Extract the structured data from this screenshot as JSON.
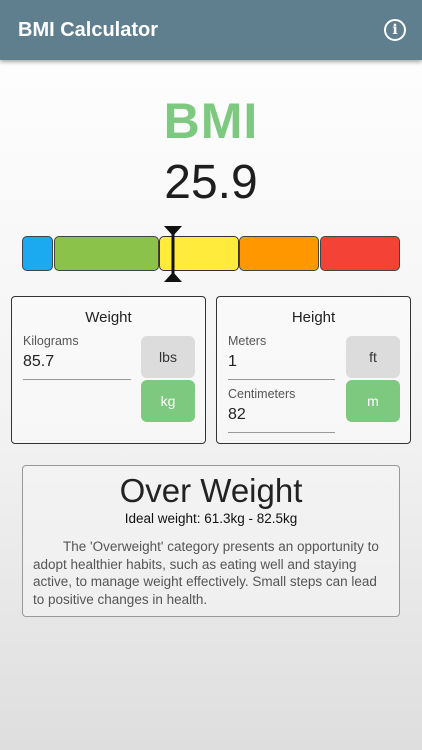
{
  "app": {
    "title": "BMI Calculator",
    "info_icon": "info-circle-icon"
  },
  "bmi": {
    "label": "BMI",
    "value": "25.9",
    "label_color": "#7dc97f"
  },
  "scale": {
    "segments": [
      {
        "name": "underweight",
        "color": "#1ba9f0"
      },
      {
        "name": "normal",
        "color": "#8bc34a"
      },
      {
        "name": "overweight",
        "color": "#ffeb3b"
      },
      {
        "name": "obese",
        "color": "#ff9800"
      },
      {
        "name": "extremely-obese",
        "color": "#f44336"
      }
    ],
    "active_segment": "overweight"
  },
  "weight": {
    "title": "Weight",
    "field_label": "Kilograms",
    "value": "85.7",
    "units": {
      "lbs": "lbs",
      "kg": "kg"
    },
    "selected_unit": "kg"
  },
  "height": {
    "title": "Height",
    "meters_label": "Meters",
    "meters_value": "1",
    "cm_label": "Centimeters",
    "cm_value": "82",
    "units": {
      "ft": "ft",
      "m": "m"
    },
    "selected_unit": "m"
  },
  "result": {
    "category": "Over Weight",
    "ideal": "Ideal weight: 61.3kg - 82.5kg",
    "description": "The 'Overweight' category presents an opportunity to adopt healthier habits, such as eating well and staying active, to manage weight effectively. Small steps can lead to positive changes in health."
  },
  "colors": {
    "appbar": "#5f7f8f",
    "unit_selected": "#7dc97f",
    "unit_unselected": "#dcdcdc"
  }
}
